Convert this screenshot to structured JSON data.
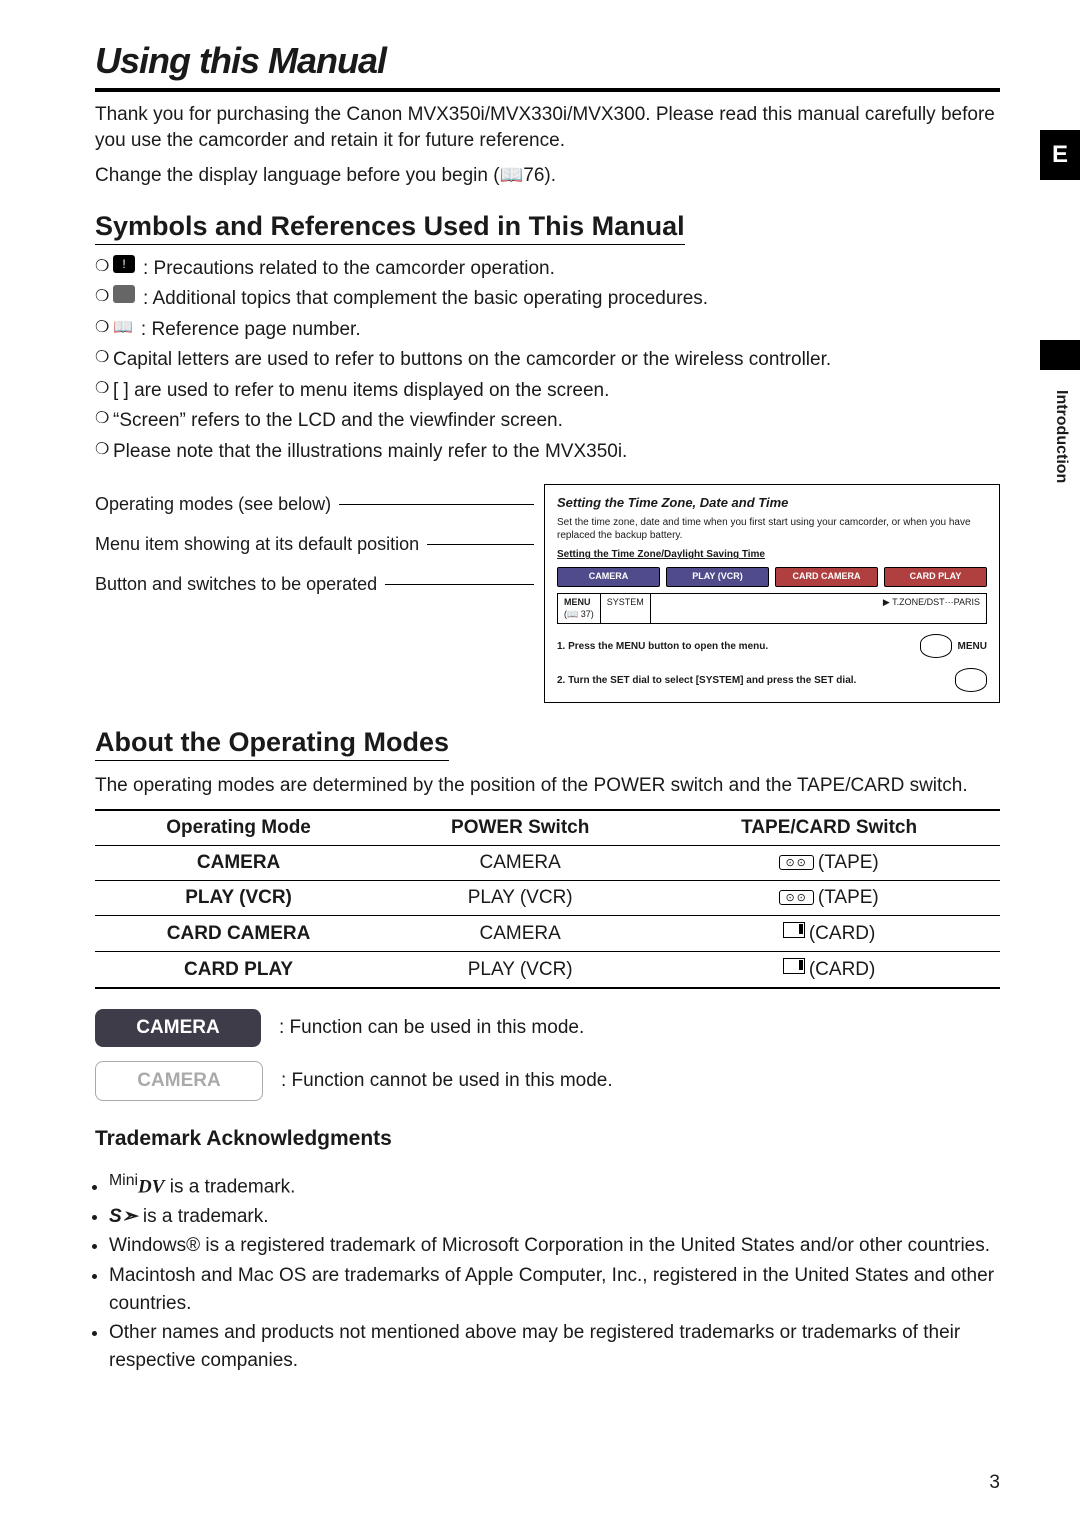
{
  "sideTab": "E",
  "sideLabel": "Introduction",
  "pageNumber": "3",
  "title": "Using this Manual",
  "intro": "Thank you for purchasing the Canon MVX350i/MVX330i/MVX300. Please read this manual carefully before you use the camcorder and retain it for future reference.",
  "intro2_pre": "Change the display language before you begin (",
  "intro2_ref": "76",
  "intro2_post": ").",
  "section1": "Symbols and References Used in This Manual",
  "sym": {
    "precautions": ": Precautions related to the camcorder operation.",
    "additional": ": Additional topics that complement the basic operating procedures.",
    "reference": ": Reference page number.",
    "capitals": "Capital letters are used to refer to buttons on the camcorder or the wireless controller.",
    "brackets": "[ ] are used to refer to menu items displayed on the screen.",
    "screen": "“Screen” refers to the LCD and the viewfinder screen.",
    "illustrations": "Please note that the illustrations mainly refer to the MVX350i."
  },
  "callouts": {
    "l1": "Operating modes (see below)",
    "l2": "Menu item showing at its default position",
    "l3": "Button and switches to be operated"
  },
  "excerpt": {
    "hdr": "Setting the Time Zone, Date and Time",
    "desc": "Set the time zone, date and time when you first start using your camcorder, or when you have replaced the backup battery.",
    "sub": "Setting the Time Zone/Daylight Saving Time",
    "chips": [
      "CAMERA",
      "PLAY (VCR)",
      "CARD CAMERA",
      "CARD PLAY"
    ],
    "menu_l": "MENU",
    "menu_ref": "(📖 37)",
    "menu_sys": "SYSTEM",
    "menu_r": "T.ZONE/DST···PARIS",
    "step1": "1.  Press the MENU button to open the menu.",
    "step1_icon": "MENU",
    "step2": "2.  Turn the SET dial to select [SYSTEM] and press the SET dial."
  },
  "section2": "About the Operating Modes",
  "modesIntro": "The operating modes are determined by the position of the POWER switch and the TAPE/CARD switch.",
  "table": {
    "headers": [
      "Operating Mode",
      "POWER Switch",
      "TAPE/CARD Switch"
    ],
    "rows": [
      {
        "mode": "CAMERA",
        "power": "CAMERA",
        "tc": "(TAPE)",
        "icon": "tape"
      },
      {
        "mode": "PLAY (VCR)",
        "power": "PLAY (VCR)",
        "tc": "(TAPE)",
        "icon": "tape"
      },
      {
        "mode": "CARD CAMERA",
        "power": "CAMERA",
        "tc": "(CARD)",
        "icon": "card"
      },
      {
        "mode": "CARD PLAY",
        "power": "PLAY (VCR)",
        "tc": "(CARD)",
        "icon": "card"
      }
    ]
  },
  "legend": {
    "enabled_chip": "CAMERA",
    "enabled_text": ": Function can be used in this mode.",
    "disabled_chip": "CAMERA",
    "disabled_text": ": Function cannot be used in this mode."
  },
  "trademarkHdr": "Trademark Acknowledgments",
  "tm": {
    "dv_pre": "Mini",
    "dv_logo": "DV",
    "dv_post": " is a trademark.",
    "sd_logo": "S➣",
    "sd_post": " is a trademark.",
    "windows": "Windows® is a registered trademark of Microsoft Corporation in the United States and/or other countries.",
    "mac": "Macintosh and Mac OS are trademarks of Apple Computer, Inc., registered in the United States and other countries.",
    "other": "Other names and products not mentioned above may be registered trademarks or trademarks of their respective companies."
  }
}
